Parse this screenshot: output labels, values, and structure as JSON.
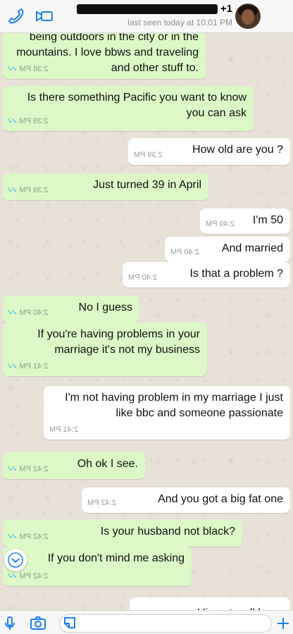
{
  "header": {
    "contact_name": "+1",
    "status": "last seen today at 10:01 PM"
  },
  "messages": [
    {
      "text": "being outdoors in the city or in the mountains. I love bbws and traveling and other stuff to.",
      "time": "2:38 PM",
      "direction": "outgoing",
      "read": true
    },
    {
      "text": "Is there something Pacific you want to know you can ask",
      "time": "2:39 PM",
      "direction": "outgoing",
      "read": true
    },
    {
      "text": "How old are you ?",
      "time": "2:39 PM",
      "direction": "incoming"
    },
    {
      "text": "Just turned 39 in April",
      "time": "2:39 PM",
      "direction": "outgoing",
      "read": true
    },
    {
      "text": "I'm 50",
      "time": "2:40 PM",
      "direction": "incoming"
    },
    {
      "text": "And married",
      "time": "2:40 PM",
      "direction": "incoming"
    },
    {
      "text": "Is that a problem ?",
      "time": "2:40 PM",
      "direction": "incoming"
    },
    {
      "text": "No I guess",
      "time": "2:40 PM",
      "direction": "outgoing",
      "read": true
    },
    {
      "text": "If you're having problems in your marriage it's not my business",
      "time": "2:41 PM",
      "direction": "outgoing",
      "read": true
    },
    {
      "text": "I'm not having problem in my marriage I just like bbc and someone passionate",
      "time": "2:41 PM",
      "direction": "incoming"
    },
    {
      "text": "Oh ok I see.",
      "time": "2:42 PM",
      "direction": "outgoing",
      "read": true
    },
    {
      "text": "And you got a big fat one",
      "time": "2:42 PM",
      "direction": "incoming"
    },
    {
      "text": "Is your husband not black?",
      "time": "2:42 PM",
      "direction": "outgoing",
      "read": true
    },
    {
      "text": "If you don't mind me asking",
      "time": "2:42 PM",
      "direction": "outgoing",
      "read": true
    },
    {
      "text": "His not well hung",
      "time": "",
      "direction": "incoming"
    }
  ],
  "colors": {
    "outgoing_bubble": "#dcf8c6",
    "incoming_bubble": "#ffffff",
    "accent": "#1b7ff0",
    "read_ticks": "#34b7f1"
  },
  "icons": {
    "call": "phone-icon",
    "video": "video-camera-icon",
    "mic": "microphone-icon",
    "camera": "camera-icon",
    "sticker": "sticker-icon",
    "attach": "plus-icon",
    "scroll": "chevron-down-icon"
  }
}
